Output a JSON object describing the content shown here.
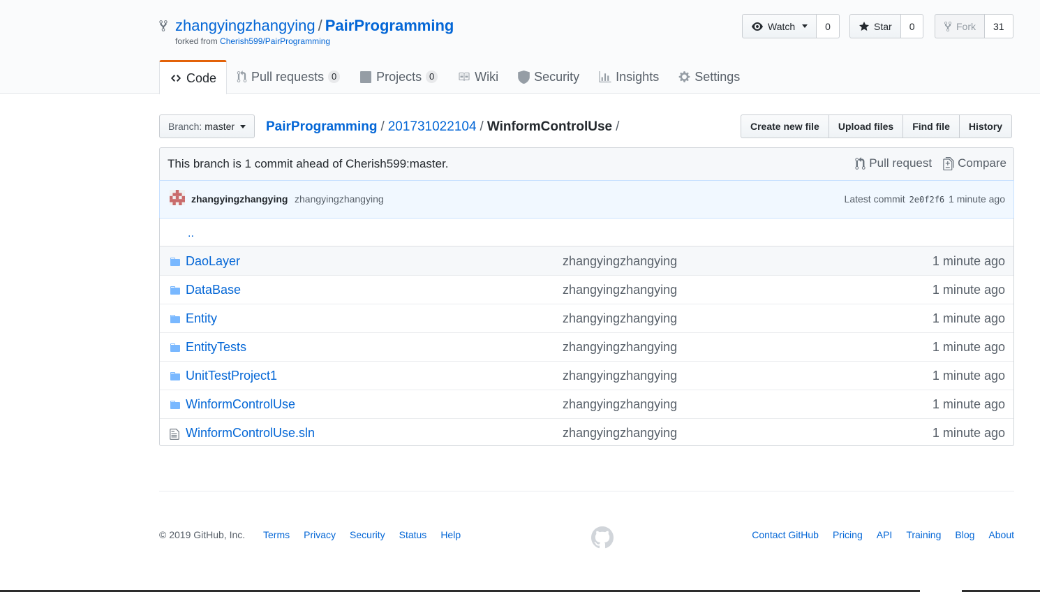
{
  "repo": {
    "owner": "zhangyingzhangying",
    "separator": "/",
    "name": "PairProgramming",
    "forked_prefix": "forked from",
    "forked_source": "Cherish599/PairProgramming"
  },
  "actions": {
    "watch": {
      "label": "Watch",
      "count": "0"
    },
    "star": {
      "label": "Star",
      "count": "0"
    },
    "fork": {
      "label": "Fork",
      "count": "31"
    }
  },
  "nav": {
    "code": "Code",
    "pull_requests": {
      "label": "Pull requests",
      "count": "0"
    },
    "projects": {
      "label": "Projects",
      "count": "0"
    },
    "wiki": "Wiki",
    "security": "Security",
    "insights": "Insights",
    "settings": "Settings"
  },
  "branch": {
    "label": "Branch:",
    "value": "master"
  },
  "breadcrumb": {
    "repo": "PairProgramming",
    "folder": "201731022104",
    "current": "WinformControlUse",
    "separator": "/"
  },
  "file_actions": {
    "create": "Create new file",
    "upload": "Upload files",
    "find": "Find file",
    "history": "History"
  },
  "infobar": {
    "message": "This branch is 1 commit ahead of Cherish599:master.",
    "pull_request": "Pull request",
    "compare": "Compare"
  },
  "commit": {
    "author": "zhangyingzhangying",
    "message": "zhangyingzhangying",
    "latest_label": "Latest commit",
    "sha": "2e0f2f6",
    "age": "1 minute ago"
  },
  "up_tree": "..",
  "files": [
    {
      "name": "DaoLayer",
      "type": "folder",
      "message": "zhangyingzhangying",
      "age": "1 minute ago"
    },
    {
      "name": "DataBase",
      "type": "folder",
      "message": "zhangyingzhangying",
      "age": "1 minute ago"
    },
    {
      "name": "Entity",
      "type": "folder",
      "message": "zhangyingzhangying",
      "age": "1 minute ago"
    },
    {
      "name": "EntityTests",
      "type": "folder",
      "message": "zhangyingzhangying",
      "age": "1 minute ago"
    },
    {
      "name": "UnitTestProject1",
      "type": "folder",
      "message": "zhangyingzhangying",
      "age": "1 minute ago"
    },
    {
      "name": "WinformControlUse",
      "type": "folder",
      "message": "zhangyingzhangying",
      "age": "1 minute ago"
    },
    {
      "name": "WinformControlUse.sln",
      "type": "file",
      "message": "zhangyingzhangying",
      "age": "1 minute ago"
    }
  ],
  "footer": {
    "copyright": "© 2019 GitHub, Inc.",
    "left_links": [
      "Terms",
      "Privacy",
      "Security",
      "Status",
      "Help"
    ],
    "right_links": [
      "Contact GitHub",
      "Pricing",
      "API",
      "Training",
      "Blog",
      "About"
    ]
  },
  "colors": {
    "link": "#0366d6",
    "muted": "#586069",
    "selected_tab_accent": "#e36209",
    "commit_bg": "#f1f8ff",
    "folder_icon": "#79b8ff"
  },
  "icons": {
    "repo": "repo-forked-icon",
    "watch": "eye-icon",
    "star": "star-icon",
    "fork": "repo-forked-icon",
    "code": "code-icon",
    "pull_request": "git-pull-request-icon",
    "projects": "project-icon",
    "wiki": "book-icon",
    "security": "shield-icon",
    "insights": "graph-icon",
    "settings": "gear-icon",
    "compare": "diff-icon",
    "folder": "folder-icon",
    "file": "file-icon",
    "footer": "github-mark-icon"
  }
}
